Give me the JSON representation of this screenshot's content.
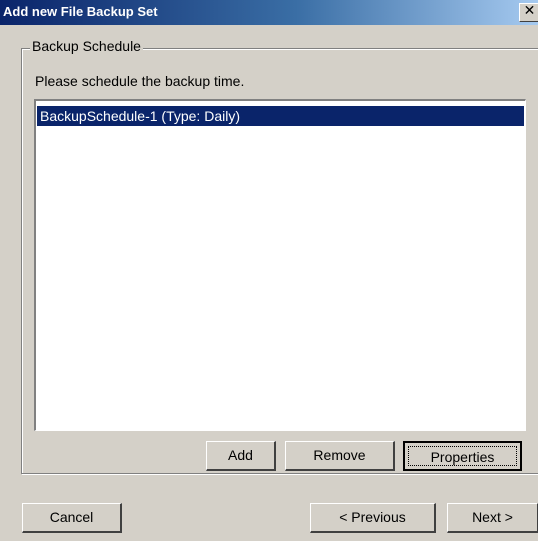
{
  "window": {
    "title": "Add new File Backup Set",
    "close_glyph": "✕"
  },
  "backup_schedule": {
    "group_label": "Backup Schedule",
    "instruction": "Please schedule the backup time.",
    "items": [
      {
        "label": "BackupSchedule-1 (Type: Daily)",
        "selected": true
      }
    ],
    "add_label": "Add",
    "remove_label": "Remove",
    "properties_label": "Properties"
  },
  "footer": {
    "cancel_label": "Cancel",
    "previous_label": "< Previous",
    "next_label": "Next >"
  },
  "colors": {
    "title_bar": "#0a246a",
    "selection": "#0a246a",
    "dialog_background": "#d4d0c8"
  }
}
